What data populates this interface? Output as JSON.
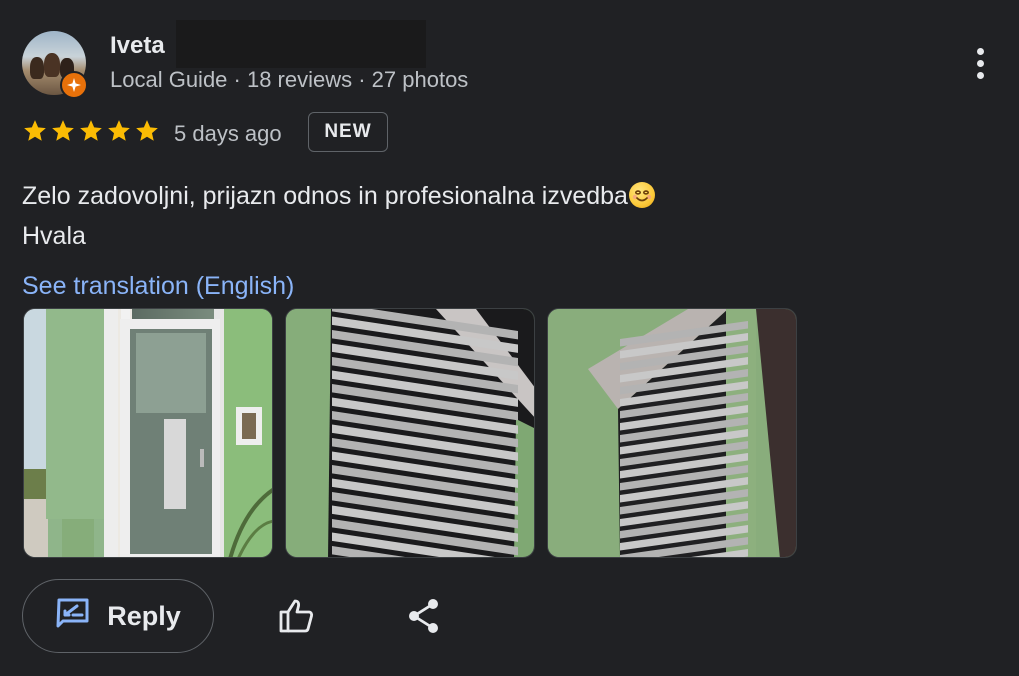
{
  "reviewer": {
    "name": "Iveta",
    "meta": "Local Guide · 18 reviews · 27 photos",
    "avatar_icon": "avatar-photo",
    "badge_icon": "local-guide-star-icon"
  },
  "rating": {
    "stars": 5,
    "max": 5,
    "color": "#fbbc04"
  },
  "date": "5 days ago",
  "badge": "NEW",
  "review": {
    "line1": "Zelo zadovoljni, prijazn odnos in profesionalna izvedba",
    "line2": "Hvala"
  },
  "translate_link": "See translation (English)",
  "photos": [
    "door-photo",
    "window-blinds-photo-1",
    "window-blinds-photo-2"
  ],
  "actions": {
    "reply_label": "Reply",
    "reply_icon": "reply-icon",
    "like_icon": "thumbs-up-icon",
    "share_icon": "share-icon"
  },
  "colors": {
    "link": "#8ab4f8",
    "accent_badge": "#e8710a",
    "background": "#202124"
  }
}
